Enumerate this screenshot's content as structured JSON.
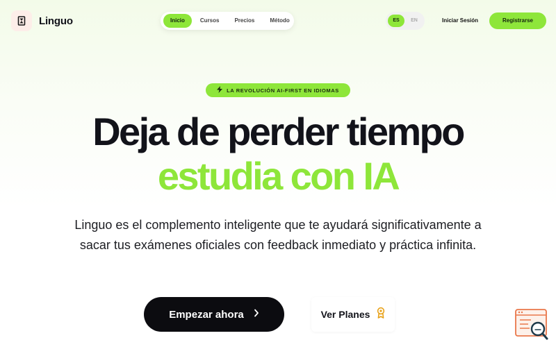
{
  "brand": {
    "name": "Linguo"
  },
  "nav": {
    "items": [
      {
        "label": "Inicio",
        "active": true
      },
      {
        "label": "Cursos",
        "active": false
      },
      {
        "label": "Precios",
        "active": false
      },
      {
        "label": "Método",
        "active": false
      }
    ]
  },
  "lang": {
    "options": [
      "ES",
      "EN"
    ],
    "selected": "ES"
  },
  "header": {
    "login_label": "Iniciar Sesión",
    "register_label": "Registrarse"
  },
  "hero": {
    "badge": "LA REVOLUCIÓN AI-FIRST EN IDIOMAS",
    "headline": "Deja de perder tiempo",
    "headline_accent": "estudia con IA",
    "subtitle": "Linguo es el complemento inteligente que te ayudará significativamente a sacar tus exámenes oficiales con feedback inmediato y práctica infinita.",
    "cta_primary": "Empezar ahora",
    "cta_secondary": "Ver Planes"
  },
  "colors": {
    "accent": "#8ee63a",
    "dark": "#0c0c10",
    "medal": "#e8a21a",
    "widget": "#e9774a"
  },
  "icons": {
    "logo": "hourglass-icon",
    "badge": "lightning-icon",
    "cta_primary": "chevron-right-icon",
    "cta_secondary": "medal-icon",
    "widget": "search-document-icon"
  }
}
